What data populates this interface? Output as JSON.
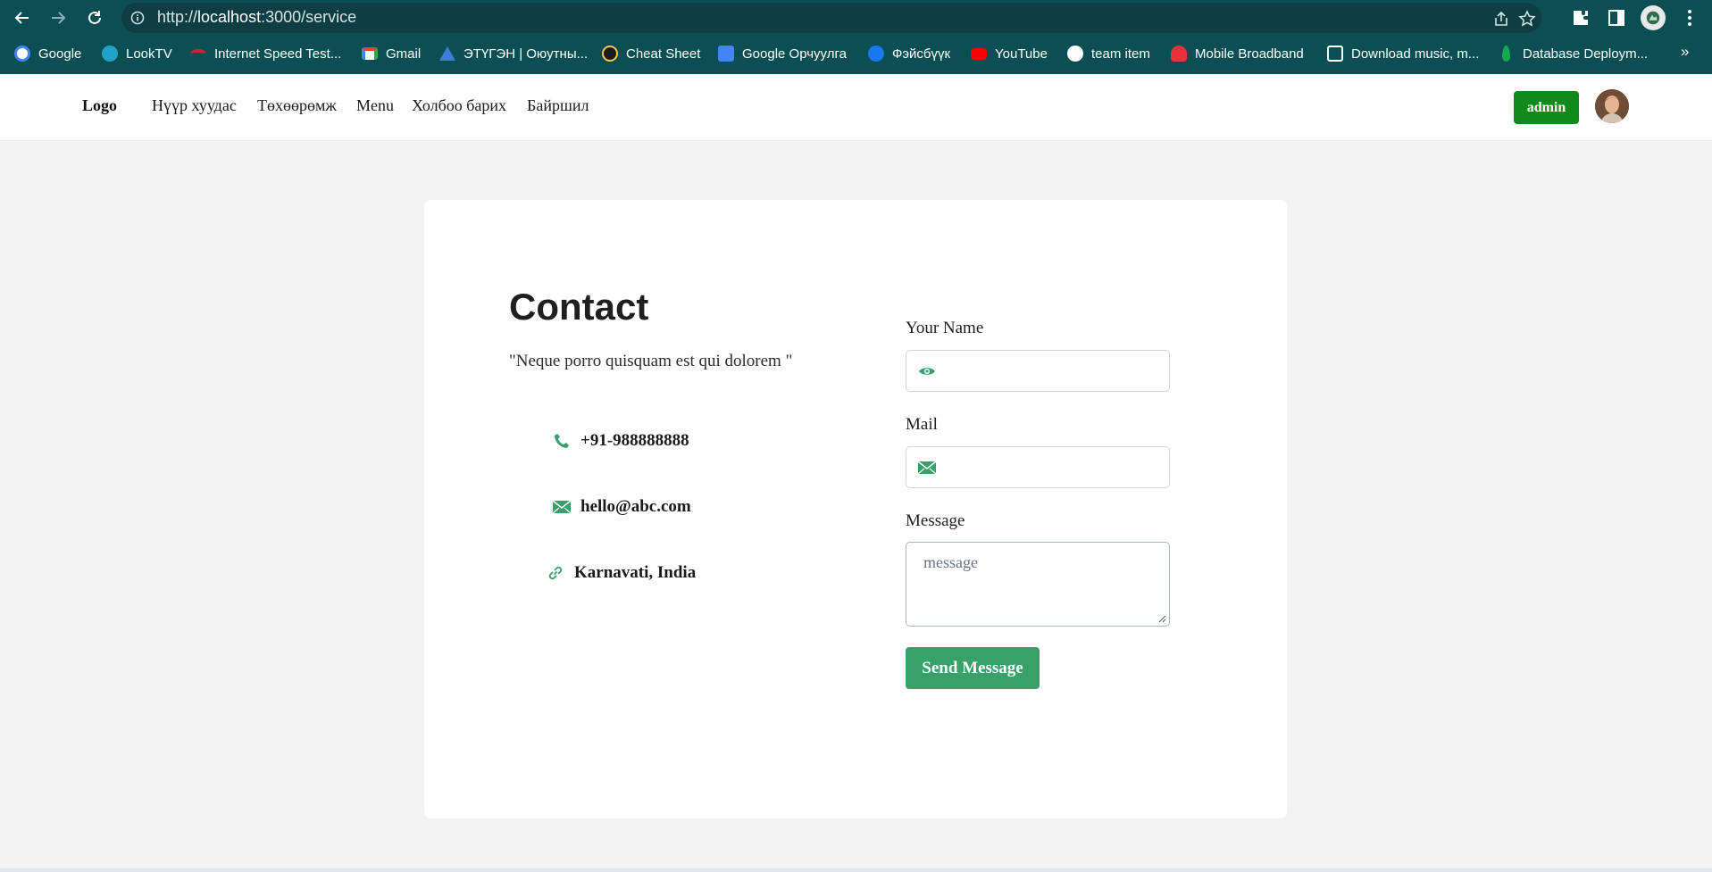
{
  "browser": {
    "url_prefix": "http://",
    "url_host": "localhost",
    "url_path": ":3000/service",
    "bookmarks": [
      {
        "label": "Google",
        "icon": "google-icon",
        "color": "#4285f4"
      },
      {
        "label": "LookTV",
        "icon": "looktv-icon",
        "color": "#1fa3c7"
      },
      {
        "label": "Internet Speed Test...",
        "icon": "speedometer-icon",
        "color": "#c4262e"
      },
      {
        "label": "Gmail",
        "icon": "gmail-icon",
        "color": "#ea4335"
      },
      {
        "label": "ЭТҮГЭН | Оюутны...",
        "icon": "etugen-icon",
        "color": "#3c7dd9"
      },
      {
        "label": "Cheat Sheet",
        "icon": "cheat-sheet-icon",
        "color": "#f2c94c"
      },
      {
        "label": "Google Орчуулга",
        "icon": "google-translate-icon",
        "color": "#4285f4"
      },
      {
        "label": "Фэйсбүүк",
        "icon": "facebook-icon",
        "color": "#1877f2"
      },
      {
        "label": "YouTube",
        "icon": "youtube-icon",
        "color": "#ff0000"
      },
      {
        "label": "team item",
        "icon": "globe-icon",
        "color": "#ffffff"
      },
      {
        "label": "Mobile Broadband",
        "icon": "huawei-icon",
        "color": "#e8333b"
      },
      {
        "label": "Download music, m...",
        "icon": "download-site-icon",
        "color": "#ffffff"
      },
      {
        "label": "Database Deploym...",
        "icon": "mongodb-icon",
        "color": "#13aa52"
      }
    ],
    "more_label": "»"
  },
  "header": {
    "logo": "Logo",
    "nav": [
      "Нүүр хуудас",
      "Төхөөрөмж",
      "Menu",
      "Холбоо барих",
      "Байршил"
    ],
    "admin_label": "admin"
  },
  "contact": {
    "title": "Contact",
    "quote": "\"Neque porro quisquam est qui dolorem \"",
    "phone": "+91-988888888",
    "email": "hello@abc.com",
    "location": "Karnavati, India",
    "accent_color": "#38a169"
  },
  "form": {
    "name_label": "Your Name",
    "name_value": "",
    "mail_label": "Mail",
    "mail_value": "",
    "message_label": "Message",
    "message_placeholder": "message",
    "send_label": "Send Message"
  }
}
